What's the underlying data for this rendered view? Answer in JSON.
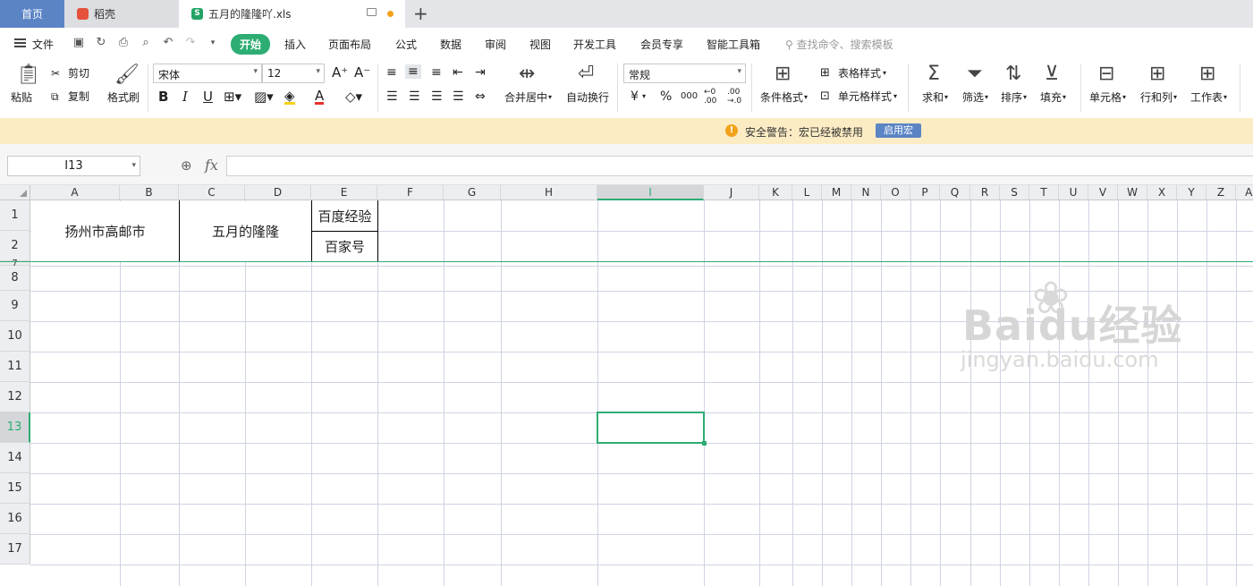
{
  "tabs": {
    "home": "首页",
    "daoke": "稻壳",
    "file": "五月的隆隆吖.xls"
  },
  "menu": {
    "file": "文件",
    "items": [
      "开始",
      "插入",
      "页面布局",
      "公式",
      "数据",
      "审阅",
      "视图",
      "开发工具",
      "会员专享",
      "智能工具箱"
    ],
    "active_index": 0,
    "search_placeholder": "查找命令、搜索模板"
  },
  "ribbon": {
    "paste": "粘贴",
    "cut": "剪切",
    "copy": "复制",
    "format_painter": "格式刷",
    "font_name": "宋体",
    "font_size": "12",
    "bold": "B",
    "italic": "I",
    "underline": "U",
    "merge_center": "合并居中",
    "wrap": "自动换行",
    "number_format": "常规",
    "currency": "¥",
    "percent": "%",
    "thousand": "000",
    "cond_format": "条件格式",
    "table_style": "表格样式",
    "cell_style": "单元格样式",
    "sum": "求和",
    "filter": "筛选",
    "sort": "排序",
    "fill": "填充",
    "cell": "单元格",
    "row_col": "行和列",
    "worksheet": "工作表"
  },
  "warning": {
    "text": "安全警告：宏已经被禁用",
    "button": "启用宏"
  },
  "formula_bar": {
    "name_box": "I13",
    "fx": "fx",
    "content": ""
  },
  "columns": [
    "A",
    "B",
    "C",
    "D",
    "E",
    "F",
    "G",
    "H",
    "I",
    "J",
    "K",
    "L",
    "M",
    "N",
    "O",
    "P",
    "Q",
    "R",
    "S",
    "T",
    "U",
    "V",
    "W",
    "X",
    "Y",
    "Z",
    "AA"
  ],
  "active_column": "I",
  "rows": [
    "1",
    "2",
    "7",
    "8",
    "9",
    "10",
    "11",
    "12",
    "13",
    "14",
    "15",
    "16",
    "17"
  ],
  "active_row": "13",
  "cells": {
    "A1": "扬州市高邮市",
    "C1": "五月的隆隆",
    "E1": "百度经验",
    "E2": "百家号"
  },
  "watermark": {
    "logo": "Baidu经验",
    "url": "jingyan.baidu.com"
  }
}
